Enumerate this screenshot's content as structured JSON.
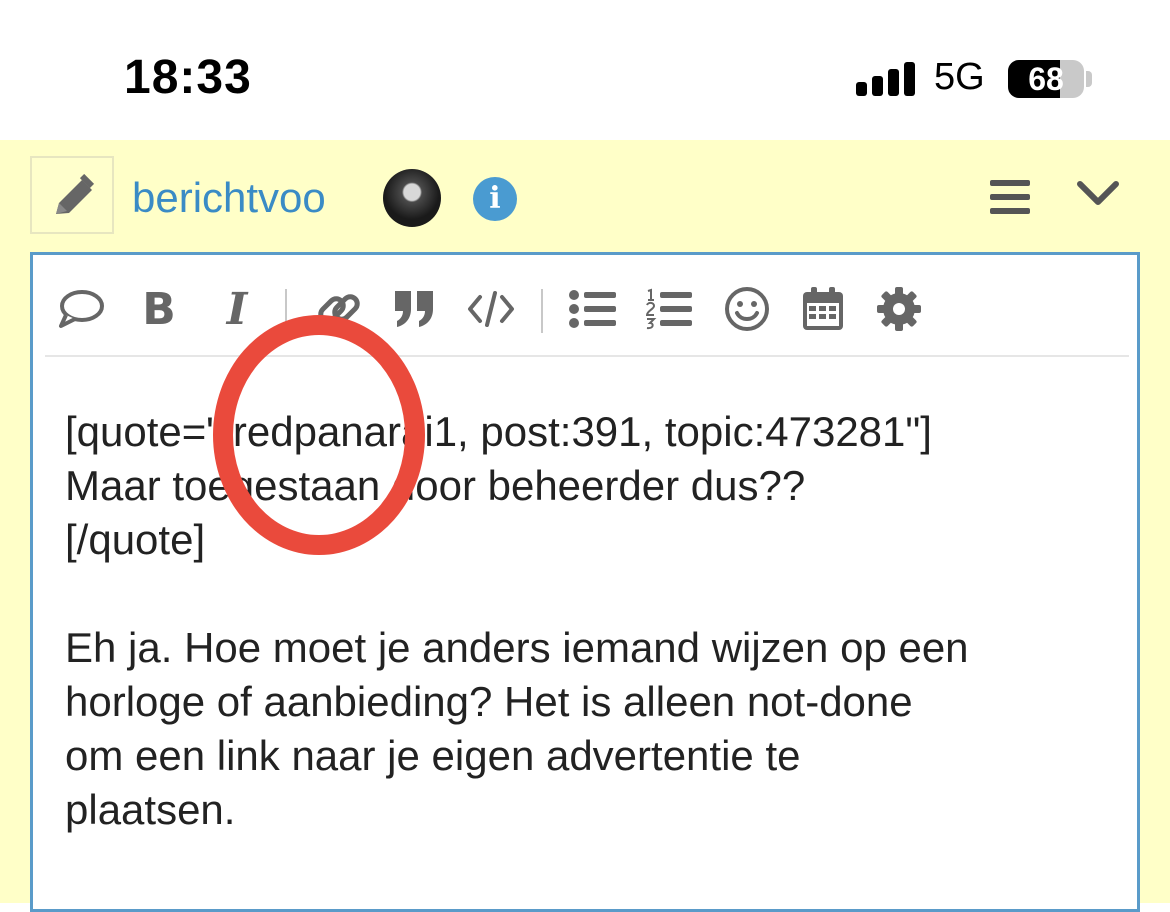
{
  "status_bar": {
    "time": "18:33",
    "network": "5G",
    "battery": "68",
    "battery_level": 0.68
  },
  "composer": {
    "title": "berichtvoo",
    "icons": [
      "pencil-icon",
      "avatar",
      "info-icon",
      "hamburger-icon",
      "chevron-down-icon"
    ],
    "info_glyph": "i"
  },
  "toolbar": {
    "buttons": [
      "quote-icon",
      "bold-icon",
      "italic-icon",
      "link-icon",
      "blockquote-icon",
      "code-icon",
      "bullet-list-icon",
      "numbered-list-icon",
      "emoji-icon",
      "calendar-icon",
      "gear-icon"
    ],
    "bold_glyph": "B",
    "italic_glyph": "I"
  },
  "editor": {
    "lines": [
      "[quote=\"fredpanarai1, post:391, topic:473281\"]",
      "Maar toegestaan door beheerder dus??",
      "[/quote]",
      "",
      "Eh ja. Hoe moet je anders iemand wijzen op een",
      "horloge of aanbieding? Het is alleen not-done",
      "om een link naar je eigen advertentie te",
      "plaatsen."
    ]
  },
  "colors": {
    "panel_bg": "#ffffc8",
    "accent": "#3a8bc5",
    "annotation": "#ea4a3c"
  }
}
